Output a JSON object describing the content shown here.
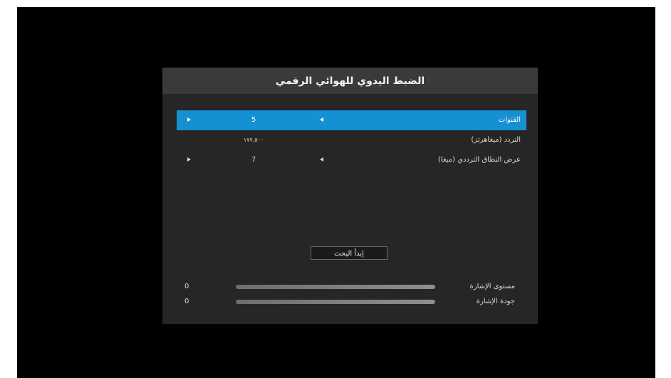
{
  "dialog": {
    "title": "الضبط اليدوي للهوائي الرقمي"
  },
  "settings": [
    {
      "label": "القنوات",
      "value": "5",
      "selected": true,
      "has_arrows": true
    },
    {
      "label": "التردد (ميغاهرتز)",
      "value": "١٧٧,٥٠٠",
      "selected": false,
      "has_arrows": false
    },
    {
      "label": "عرض النطاق الترددي (ميغا)",
      "value": "7",
      "selected": false,
      "has_arrows": true
    }
  ],
  "search_button": {
    "label": "إبدأ البحث"
  },
  "meters": [
    {
      "label": "مستوى الإشارة",
      "value": "0",
      "fill_fraction": 1.0
    },
    {
      "label": "جودة الإشارة",
      "value": "0",
      "fill_fraction": 1.0
    }
  ],
  "colors": {
    "selected_row": "#1590d3",
    "dialog_bg": "#262626",
    "title_bar_bg": "#3a3a3a"
  }
}
